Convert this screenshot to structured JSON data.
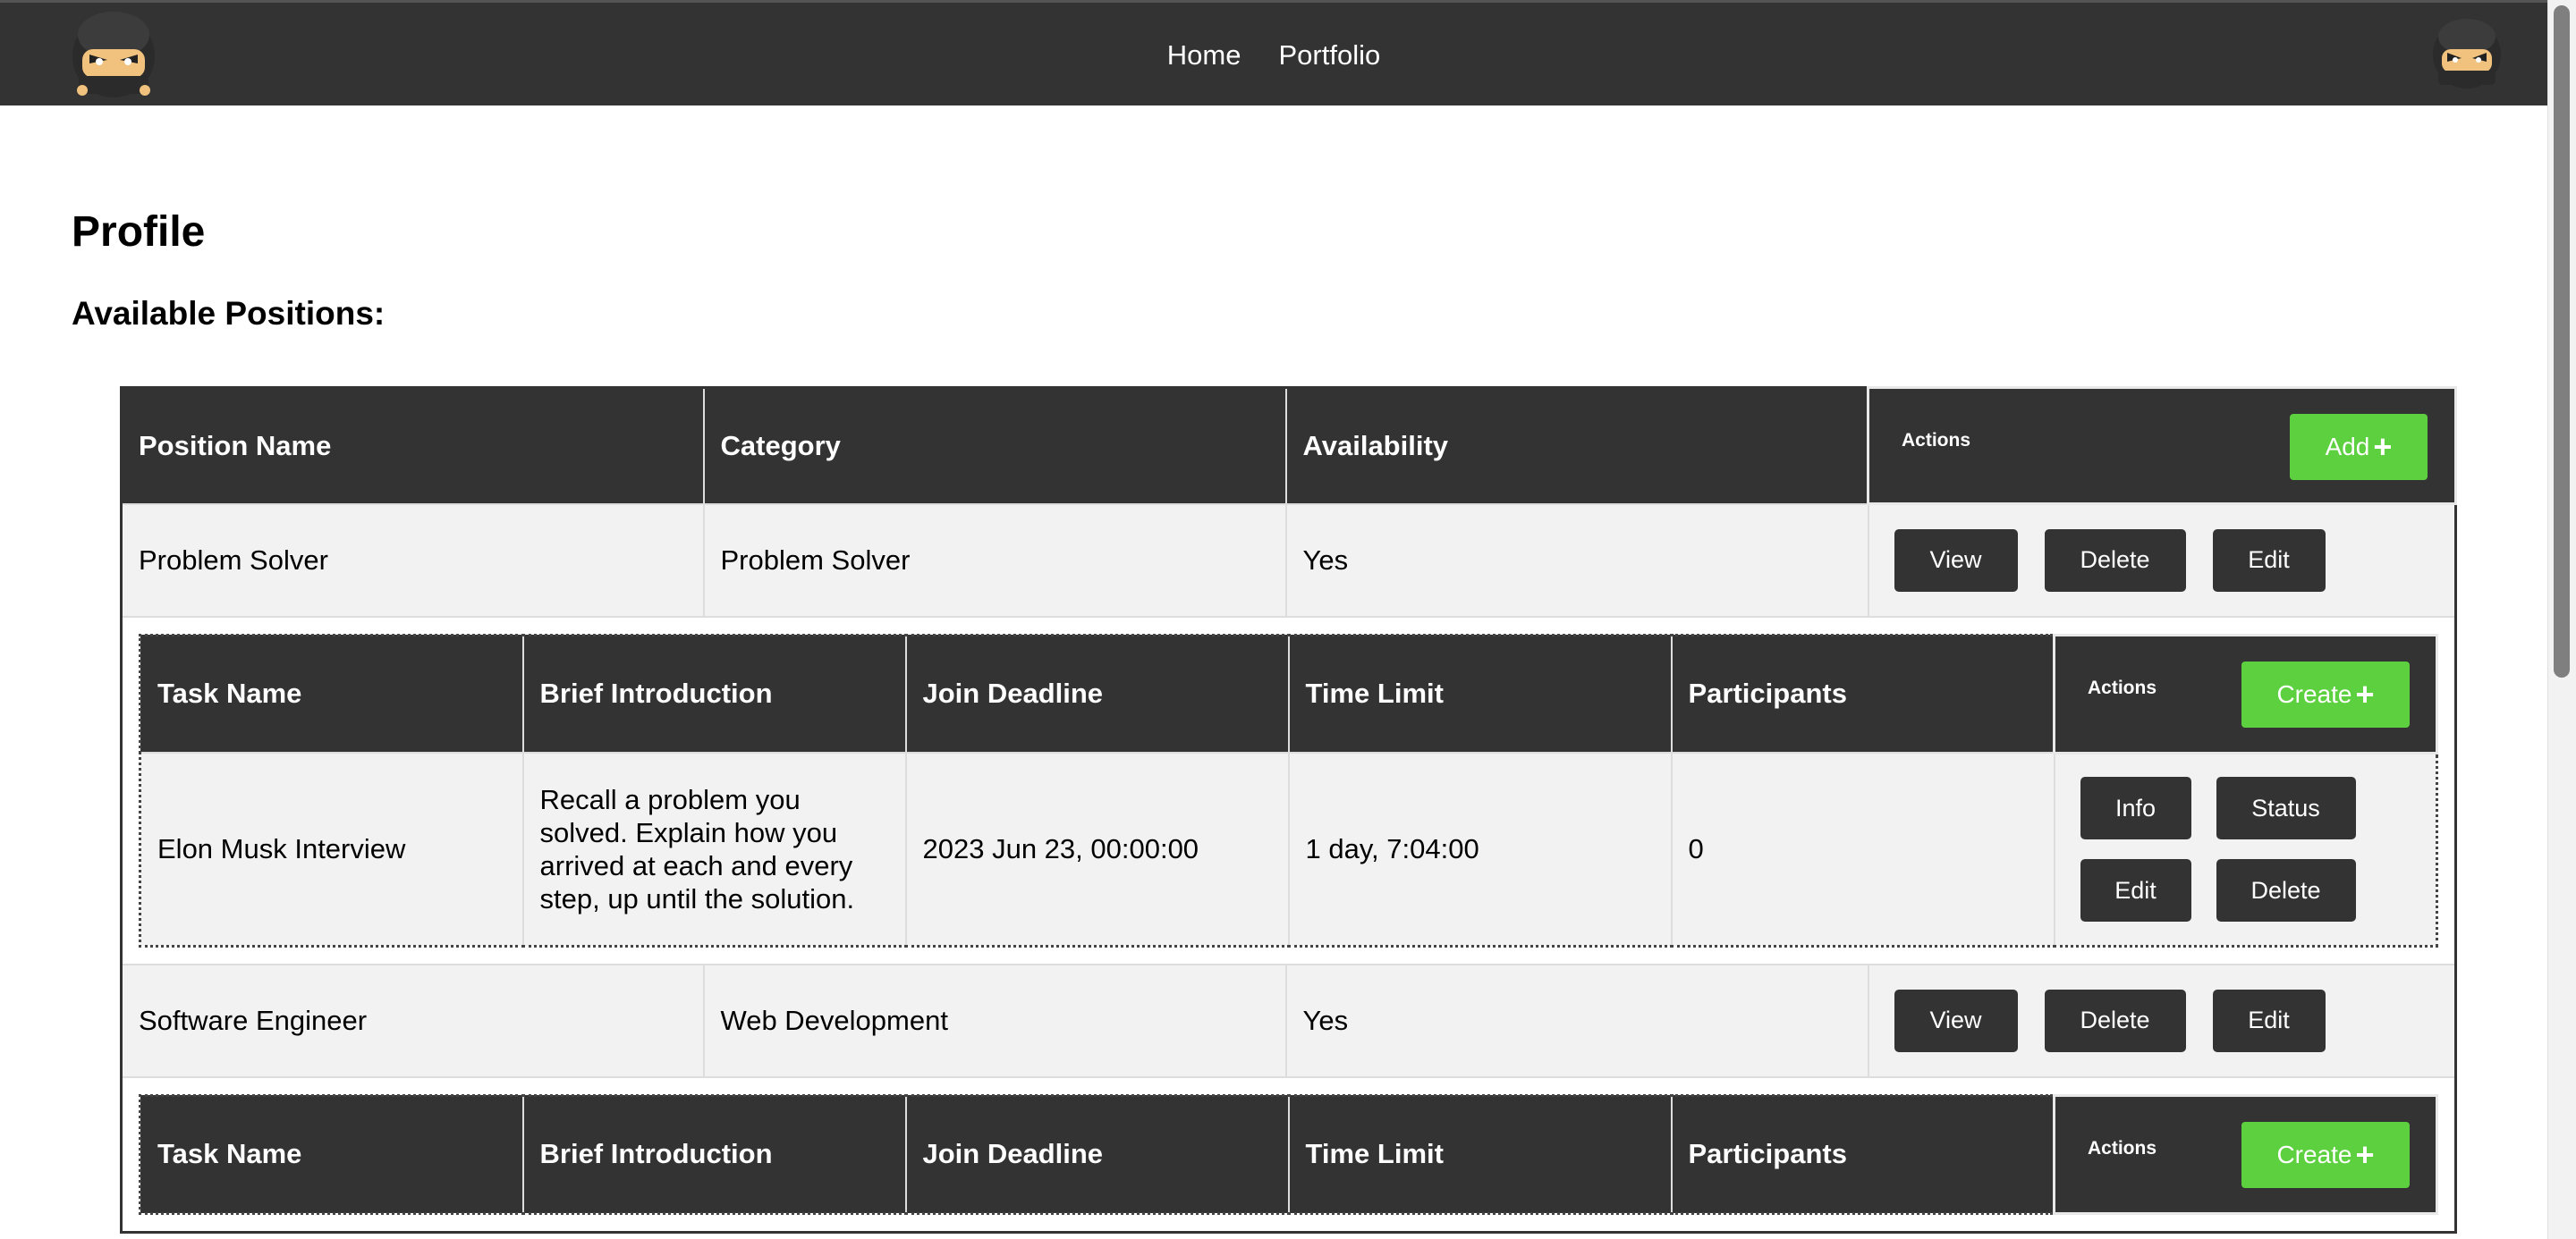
{
  "nav": {
    "links": [
      "Home",
      "Portfolio"
    ]
  },
  "page": {
    "title": "Profile",
    "section_title": "Available Positions:"
  },
  "positions_table": {
    "headers": [
      "Position Name",
      "Category",
      "Availability",
      "Actions"
    ],
    "add_label": "Add",
    "row_actions": [
      "View",
      "Delete",
      "Edit"
    ],
    "rows": [
      {
        "name": "Problem Solver",
        "category": "Problem Solver",
        "availability": "Yes"
      },
      {
        "name": "Software Engineer",
        "category": "Web Development",
        "availability": "Yes"
      }
    ]
  },
  "tasks_table": {
    "headers": [
      "Task Name",
      "Brief Introduction",
      "Join Deadline",
      "Time Limit",
      "Participants",
      "Actions"
    ],
    "create_label": "Create",
    "task_actions": [
      "Info",
      "Status",
      "Edit",
      "Delete"
    ],
    "rows": [
      {
        "name": "Elon Musk Interview",
        "intro": "Recall a problem you solved. Explain how you arrived at each and every step, up until the solution.",
        "deadline": "2023 Jun 23, 00:00:00",
        "time_limit": "1 day, 7:04:00",
        "participants": "0"
      }
    ]
  },
  "colors": {
    "navbar": "#333333",
    "header": "#333333",
    "row_bg": "#f2f2f2",
    "accent_green": "#5cd03e"
  },
  "icons": [
    "ninja-logo-icon",
    "ninja-avatar-icon",
    "plus-icon"
  ]
}
